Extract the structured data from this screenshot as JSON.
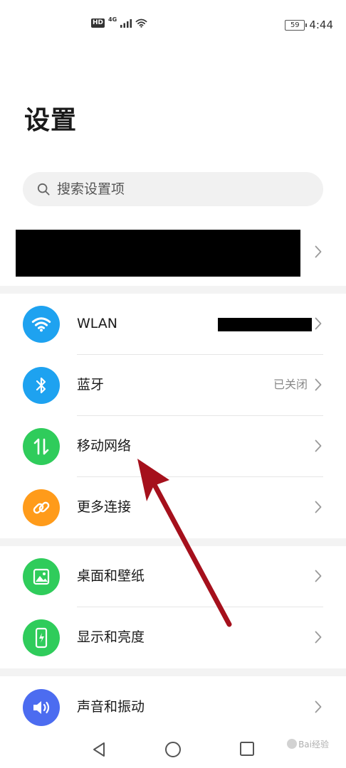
{
  "status_bar": {
    "hd": "HD",
    "network_type": "4G",
    "battery": "59",
    "time": "4:44"
  },
  "page": {
    "title": "设置"
  },
  "search": {
    "placeholder": "搜索设置项"
  },
  "sections": [
    {
      "items": [
        {
          "label": "WLAN",
          "icon": "wifi-icon",
          "color": "#1ea2f0"
        },
        {
          "label": "蓝牙",
          "value": "已关闭",
          "icon": "bluetooth-icon",
          "color": "#1ea2f0"
        },
        {
          "label": "移动网络",
          "icon": "mobile-data-icon",
          "color": "#2fcc5b"
        },
        {
          "label": "更多连接",
          "icon": "link-icon",
          "color": "#ff9b1a"
        }
      ]
    },
    {
      "items": [
        {
          "label": "桌面和壁纸",
          "icon": "wallpaper-icon",
          "color": "#2fcc5b"
        },
        {
          "label": "显示和亮度",
          "icon": "display-icon",
          "color": "#2fcc5b"
        }
      ]
    },
    {
      "items": [
        {
          "label": "声音和振动",
          "icon": "sound-icon",
          "color": "#4c6cf0"
        }
      ]
    }
  ],
  "annotation": {
    "arrow_color": "#a5101c"
  },
  "watermark": {
    "text": "Bai经验"
  }
}
